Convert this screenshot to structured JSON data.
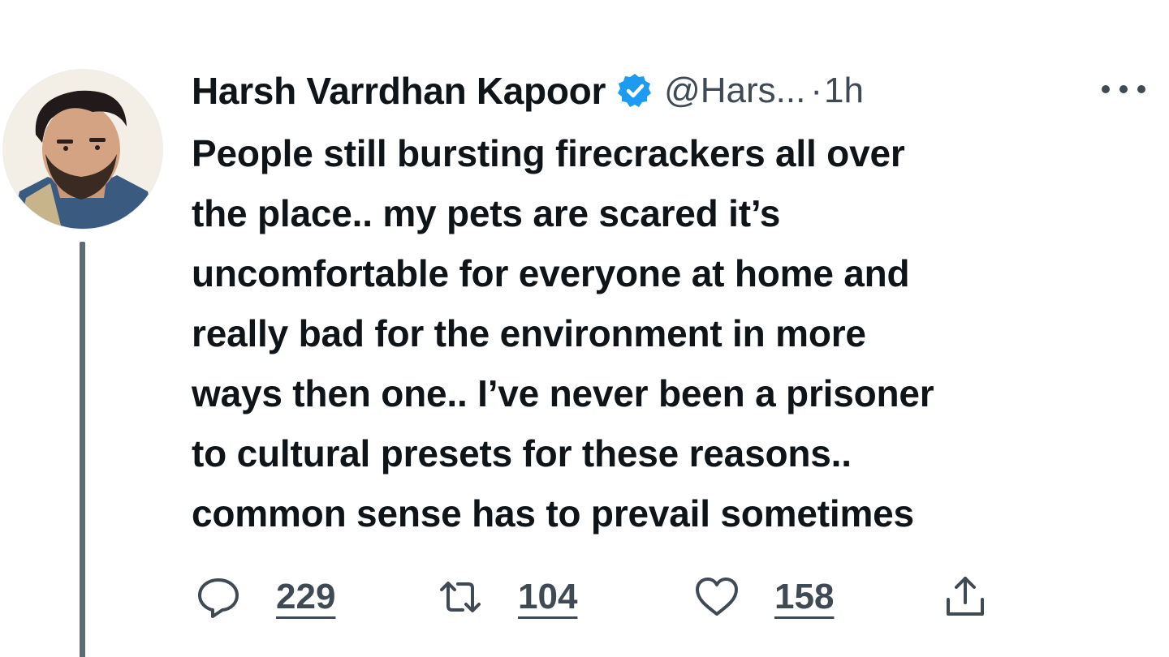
{
  "tweet": {
    "author_name": "Harsh Varrdhan Kapoor",
    "handle": "@Hars...",
    "separator": "·",
    "time": "1h",
    "lines": [
      "People still bursting firecrackers all over",
      "the place.. my pets are scared it’s",
      "uncomfortable for everyone at home and",
      "really bad for the environment in more",
      "ways then one.. I’ve never been a prisoner",
      "to cultural presets for these reasons..",
      "common sense has to prevail sometimes"
    ]
  },
  "actions": {
    "replies": "229",
    "retweets": "104",
    "likes": "158"
  },
  "colors": {
    "verified_badge": "#1d9bf0",
    "text": "#0f1419",
    "secondary": "#3f4a54",
    "thread_line": "#5f6b74"
  },
  "icons": [
    "avatar",
    "verified-badge-icon",
    "more-icon",
    "reply-icon",
    "retweet-icon",
    "like-icon",
    "share-icon"
  ]
}
